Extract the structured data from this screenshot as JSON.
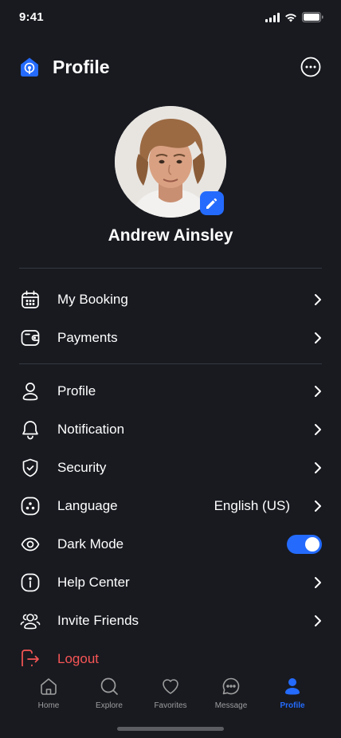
{
  "status_bar": {
    "time": "9:41"
  },
  "header": {
    "title": "Profile"
  },
  "user": {
    "name": "Andrew Ainsley"
  },
  "menu": {
    "my_booking": "My Booking",
    "payments": "Payments",
    "profile": "Profile",
    "notification": "Notification",
    "security": "Security",
    "language": "Language",
    "language_value": "English (US)",
    "dark_mode": "Dark Mode",
    "dark_mode_on": true,
    "help_center": "Help Center",
    "invite_friends": "Invite Friends",
    "logout": "Logout"
  },
  "bottom_nav": {
    "home": "Home",
    "explore": "Explore",
    "favorites": "Favorites",
    "message": "Message",
    "profile": "Profile",
    "active": "profile"
  },
  "colors": {
    "background": "#181a20",
    "accent": "#246bfd",
    "danger": "#f75555",
    "divider": "#35383f"
  },
  "icons": [
    "home-logo-icon",
    "more-icon",
    "edit-icon",
    "calendar-icon",
    "wallet-icon",
    "user-icon",
    "bell-icon",
    "shield-icon",
    "language-icon",
    "eye-icon",
    "info-icon",
    "users-icon",
    "logout-icon",
    "chevron-right-icon",
    "home-icon",
    "search-icon",
    "heart-icon",
    "chat-icon",
    "profile-icon"
  ]
}
